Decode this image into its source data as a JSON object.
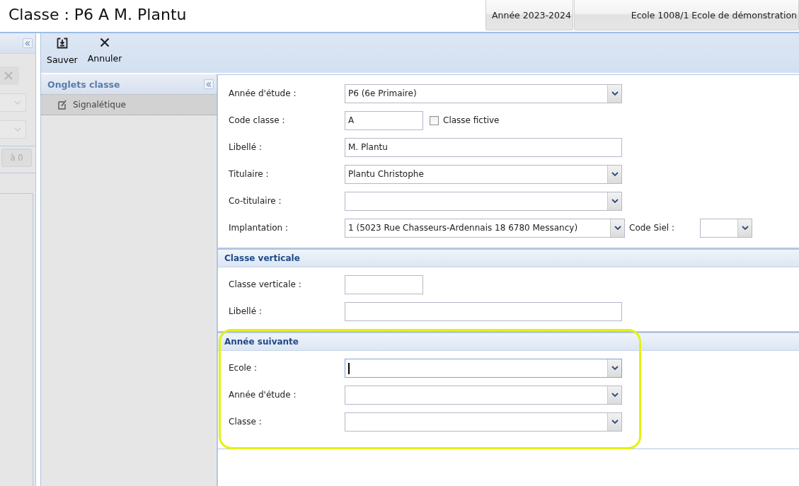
{
  "header": {
    "title": "Classe : P6 A M. Plantu",
    "tabs": [
      {
        "label": "Année 2023-2024"
      },
      {
        "label": "Ecole 1008/1 Ecole de démonstration"
      }
    ]
  },
  "left_panel": {
    "reset_button": {
      "label": "à 0",
      "disabled": true
    }
  },
  "toolbar": {
    "buttons": [
      {
        "label": "Sauver",
        "kind": "save"
      },
      {
        "label": "Annuler",
        "kind": "cancel"
      }
    ]
  },
  "tabs_panel": {
    "title": "Onglets classe",
    "items": [
      {
        "label": "Signalétique",
        "selected": true
      }
    ]
  },
  "form": {
    "sections": [
      {
        "highlighted": false,
        "fields": [
          {
            "label": "Année d'étude :",
            "kind": "select",
            "value": "P6 (6e Primaire)",
            "focused": false
          },
          {
            "label": "Code classe :",
            "kind": "short_text",
            "value": "A",
            "focused": false,
            "checkbox": {
              "label": "Classe fictive",
              "checked": false
            }
          },
          {
            "label": "Libellé :",
            "kind": "text",
            "value": "M. Plantu",
            "focused": false
          },
          {
            "label": "Titulaire :",
            "kind": "select",
            "value": "Plantu Christophe",
            "focused": false
          },
          {
            "label": "Co-titulaire :",
            "kind": "select",
            "focused": false
          },
          {
            "label": "Implantation :",
            "kind": "select",
            "value": "1 (5023 Rue Chasseurs-Ardennais 18 6780 Messancy)",
            "focused": false,
            "extra": {
              "label": "Code Siel :"
            }
          }
        ]
      },
      {
        "title": "Classe verticale",
        "highlighted": false,
        "fields": [
          {
            "label": "Classe verticale :",
            "kind": "short_text",
            "focused": false
          },
          {
            "label": "Libellé :",
            "kind": "text",
            "focused": false
          }
        ]
      },
      {
        "title": "Année suivante",
        "highlighted": true,
        "fields": [
          {
            "label": "Ecole :",
            "kind": "select",
            "focused": true
          },
          {
            "label": "Année d'étude :",
            "kind": "select",
            "focused": false
          },
          {
            "label": "Classe :",
            "kind": "select",
            "focused": false
          }
        ]
      }
    ]
  }
}
